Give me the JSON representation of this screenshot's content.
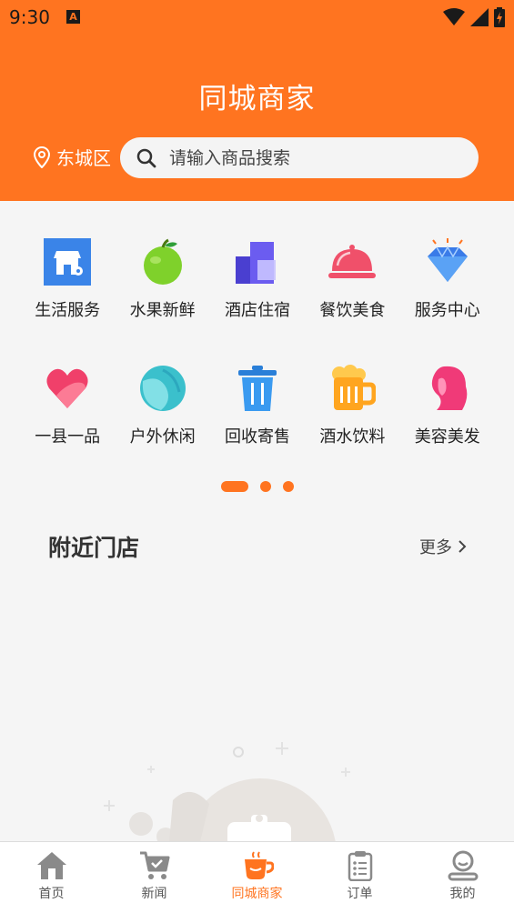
{
  "status": {
    "time": "9:30",
    "a_badge": "A"
  },
  "header": {
    "title": "同城商家"
  },
  "location": {
    "name": "东城区"
  },
  "search": {
    "placeholder": "请输入商品搜索"
  },
  "categories": [
    {
      "label": "生活服务",
      "icon": "shop-icon"
    },
    {
      "label": "水果新鲜",
      "icon": "apple-icon"
    },
    {
      "label": "酒店住宿",
      "icon": "hotel-icon"
    },
    {
      "label": "餐饮美食",
      "icon": "food-cloche-icon"
    },
    {
      "label": "服务中心",
      "icon": "diamond-icon"
    },
    {
      "label": "一县一品",
      "icon": "heart-icon"
    },
    {
      "label": "户外休闲",
      "icon": "ball-icon"
    },
    {
      "label": "回收寄售",
      "icon": "trash-can-icon"
    },
    {
      "label": "酒水饮料",
      "icon": "beer-icon"
    },
    {
      "label": "美容美发",
      "icon": "woman-hair-icon"
    }
  ],
  "pager": {
    "pages": 3,
    "active": 1
  },
  "nearby": {
    "title": "附近门店",
    "more": "更多"
  },
  "tabs": [
    {
      "label": "首页",
      "icon": "home-icon"
    },
    {
      "label": "新闻",
      "icon": "cart-icon"
    },
    {
      "label": "同城商家",
      "icon": "coffee-cup-icon",
      "active": true
    },
    {
      "label": "订单",
      "icon": "clipboard-icon"
    },
    {
      "label": "我的",
      "icon": "user-icon"
    }
  ],
  "colors": {
    "accent": "#ff7420",
    "background": "#f5f5f5"
  }
}
